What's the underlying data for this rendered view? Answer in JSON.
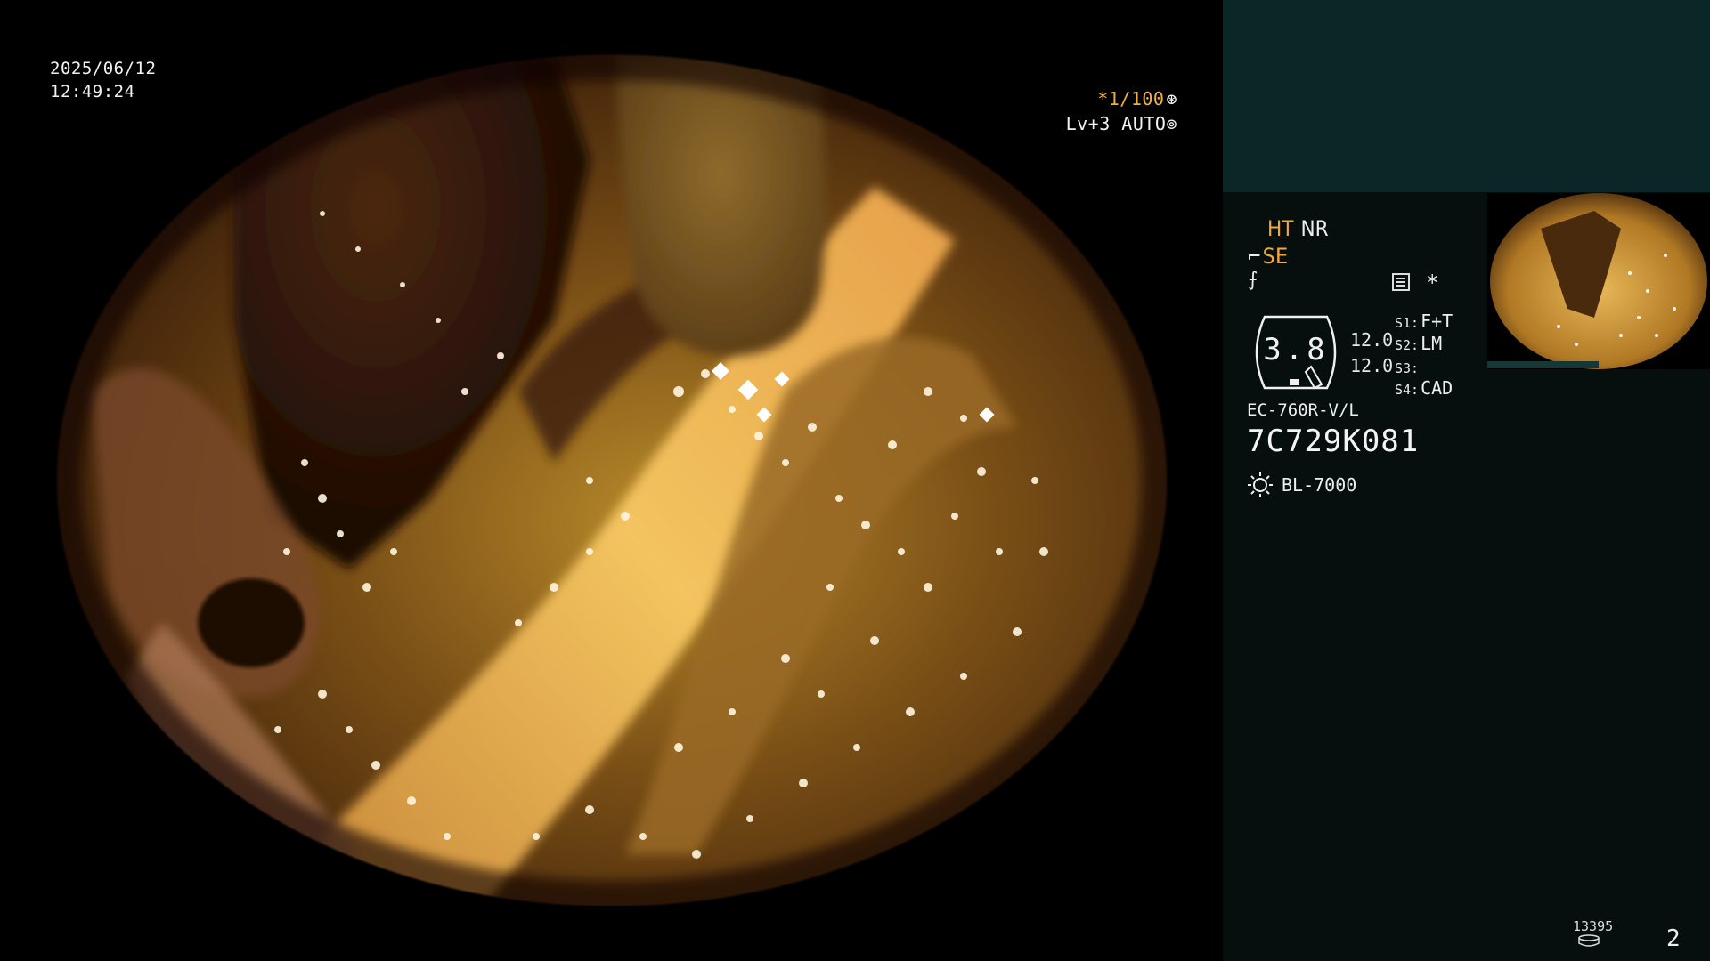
{
  "overlay": {
    "date": "2025/06/12",
    "time": "12:49:24",
    "shutter_speed": "*1/100",
    "shutter_icon": "aperture-icon",
    "level": "Lv+3 AUTO",
    "level_icon": "iris-icon"
  },
  "panel": {
    "ht_label": "HT",
    "nr_label": "NR",
    "se_label": "SE",
    "structure_icon": "structure-enhance-icon",
    "menu_icon": "menu-icon",
    "asterisk": "*",
    "zoom_value": "3.8",
    "value_1": "12.0",
    "value_2": "12.0",
    "switches": [
      {
        "key": "S1:",
        "value": "F+T"
      },
      {
        "key": "S2:",
        "value": "LM"
      },
      {
        "key": "S3:",
        "value": ""
      },
      {
        "key": "S4:",
        "value": "CAD"
      }
    ],
    "scope_model": "EC-760R-V/L",
    "serial": "7C729K081",
    "light_icon": "light-source-icon",
    "light_source": "BL-7000",
    "image_count": "13395",
    "storage_icon": "storage-icon",
    "page_number": "2"
  },
  "colors": {
    "accent_orange": "#f2a93a",
    "panel_bg": "#060e0e",
    "panel_header": "#0b2626",
    "text": "#eeeeee"
  }
}
